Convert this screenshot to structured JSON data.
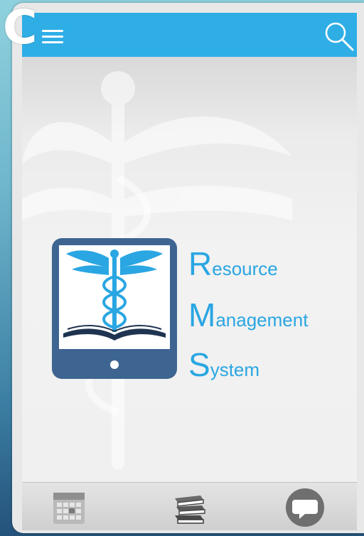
{
  "overlay": {
    "corner_letter": "C"
  },
  "header": {
    "menu_icon": "hamburger-menu-icon",
    "search_icon": "search-icon",
    "bar_color": "#2faee6"
  },
  "main": {
    "logo_icon": "tablet-caduceus-book-logo",
    "brand": {
      "line1_initial": "R",
      "line1_rest": "esource",
      "line2_initial": "M",
      "line2_rest": "anagement",
      "line3_initial": "S",
      "line3_rest": "ystem",
      "color": "#2aa6e2"
    },
    "background_watermark": "caduceus-watermark"
  },
  "bottom_nav": {
    "items": [
      {
        "icon": "calendar-icon"
      },
      {
        "icon": "books-stack-icon"
      },
      {
        "icon": "chat-bubble-icon"
      }
    ]
  }
}
